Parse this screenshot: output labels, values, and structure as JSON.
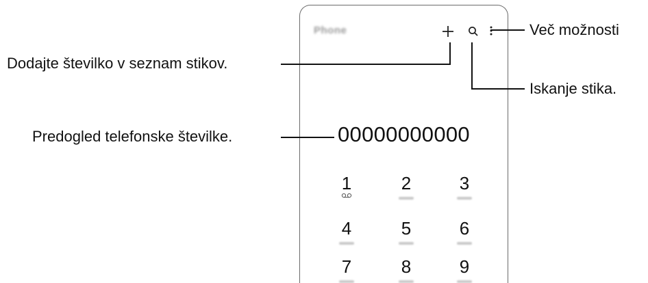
{
  "phone": {
    "app_title": "Phone",
    "add_icon": "plus-icon",
    "search_icon": "search-icon",
    "more_icon": "more-options-icon",
    "number_preview": "00000000000",
    "keypad": [
      {
        "digit": "1",
        "voicemail": true
      },
      {
        "digit": "2"
      },
      {
        "digit": "3"
      },
      {
        "digit": "4"
      },
      {
        "digit": "5"
      },
      {
        "digit": "6"
      },
      {
        "digit": "7"
      },
      {
        "digit": "8"
      },
      {
        "digit": "9"
      }
    ]
  },
  "callouts": {
    "more_options": "Več možnosti",
    "add_to_contacts": "Dodajte številko v seznam stikov.",
    "search_contact": "Iskanje stika.",
    "number_preview": "Predogled telefonske številke."
  }
}
